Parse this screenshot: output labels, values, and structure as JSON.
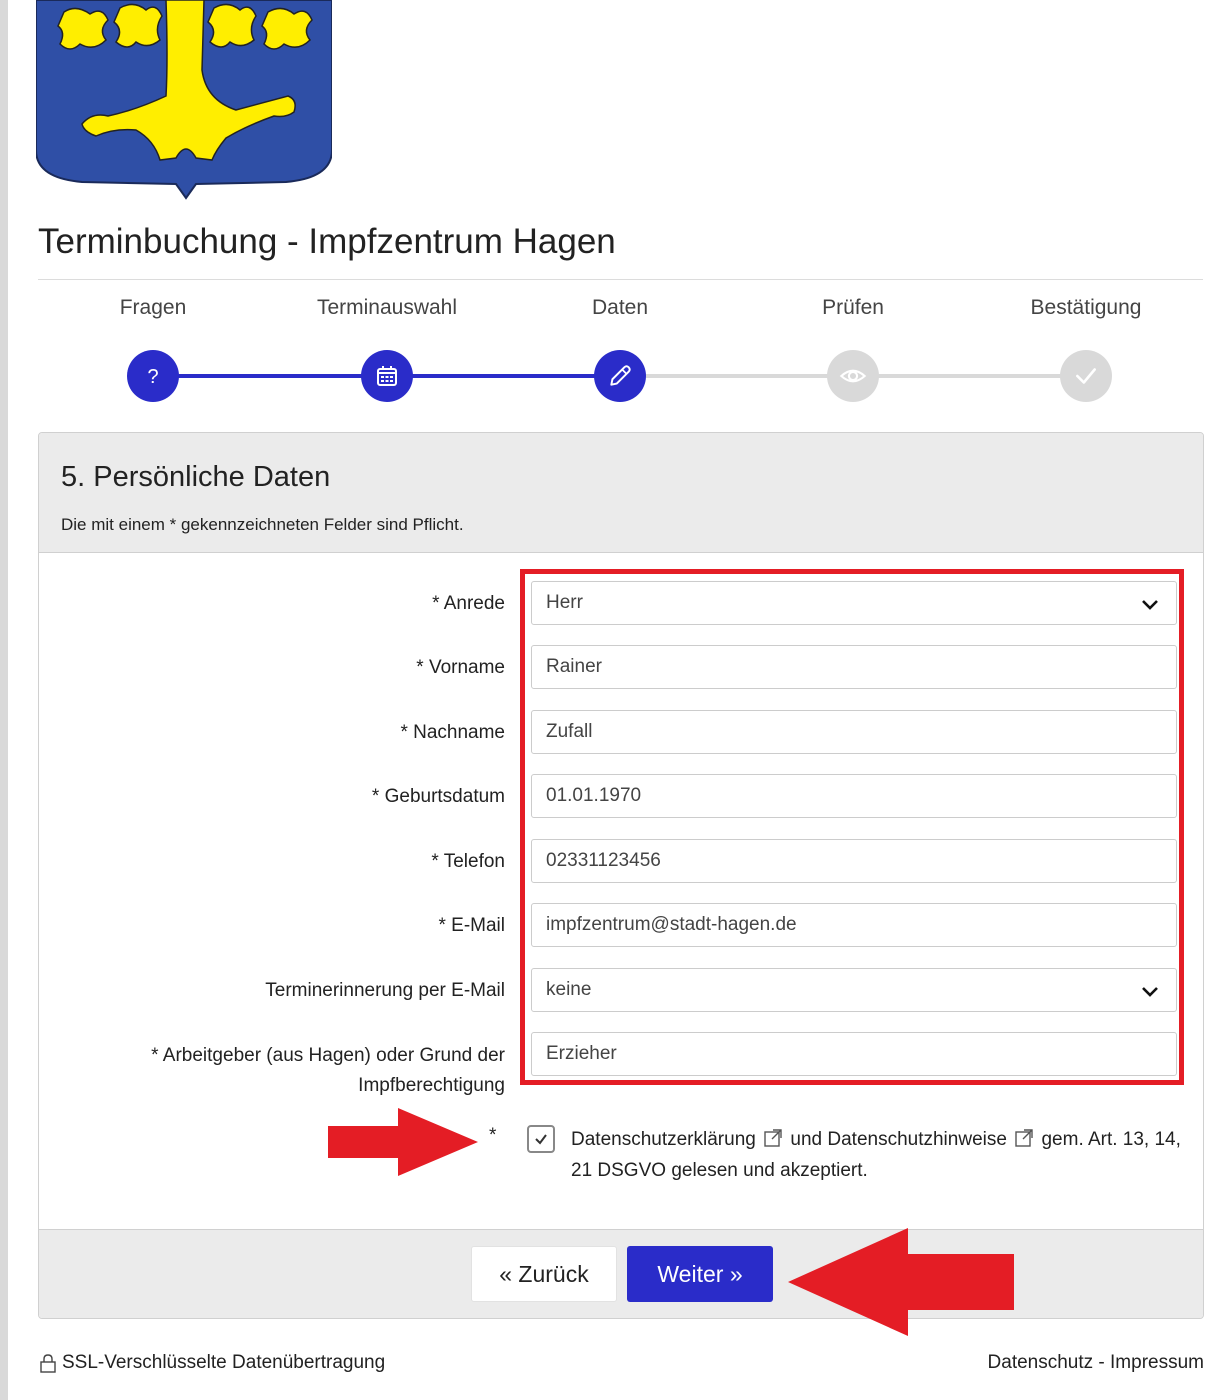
{
  "page": {
    "title": "Terminbuchung - Impfzentrum Hagen"
  },
  "steps": [
    {
      "label": "Fragen",
      "icon": "question-icon",
      "state": "done"
    },
    {
      "label": "Terminauswahl",
      "icon": "calendar-icon",
      "state": "done"
    },
    {
      "label": "Daten",
      "icon": "pencil-icon",
      "state": "active"
    },
    {
      "label": "Prüfen",
      "icon": "eye-icon",
      "state": "pending"
    },
    {
      "label": "Bestätigung",
      "icon": "check-icon",
      "state": "pending"
    }
  ],
  "form": {
    "title": "5. Persönliche Daten",
    "note": "Die mit einem * gekennzeichneten Felder sind Pflicht.",
    "fields": {
      "anrede": {
        "label": "* Anrede",
        "value": "Herr"
      },
      "vorname": {
        "label": "* Vorname",
        "value": "Rainer"
      },
      "nachname": {
        "label": "* Nachname",
        "value": "Zufall"
      },
      "geburtsdatum": {
        "label": "* Geburtsdatum",
        "value": "01.01.1970"
      },
      "telefon": {
        "label": "* Telefon",
        "value": "02331123456"
      },
      "email": {
        "label": "* E-Mail",
        "value": "impfzentrum@stadt-hagen.de"
      },
      "erinnerung": {
        "label": "Terminerinnerung per E-Mail",
        "value": "keine"
      },
      "arbeitgeber": {
        "label_line1": "* Arbeitgeber (aus Hagen) oder Grund der",
        "label_line2": "Impfberechtigung",
        "value": "Erzieher"
      }
    },
    "consent": {
      "star": "*",
      "checked": true,
      "link1": "Datenschutzerklärung",
      "mid": "und",
      "link2": "Datenschutzhinweise",
      "tail": "gem. Art. 13, 14, 21 DSGVO gelesen und akzeptiert."
    },
    "buttons": {
      "back": "« Zurück",
      "next": "Weiter »"
    }
  },
  "footer": {
    "ssl": "SSL-Verschlüsselte Datenübertragung",
    "links": "Datenschutz - Impressum"
  },
  "colors": {
    "accent": "#2a2cc9",
    "highlight": "#e41d25",
    "crest_blue": "#2f4fa6",
    "crest_yellow": "#ffee00"
  }
}
